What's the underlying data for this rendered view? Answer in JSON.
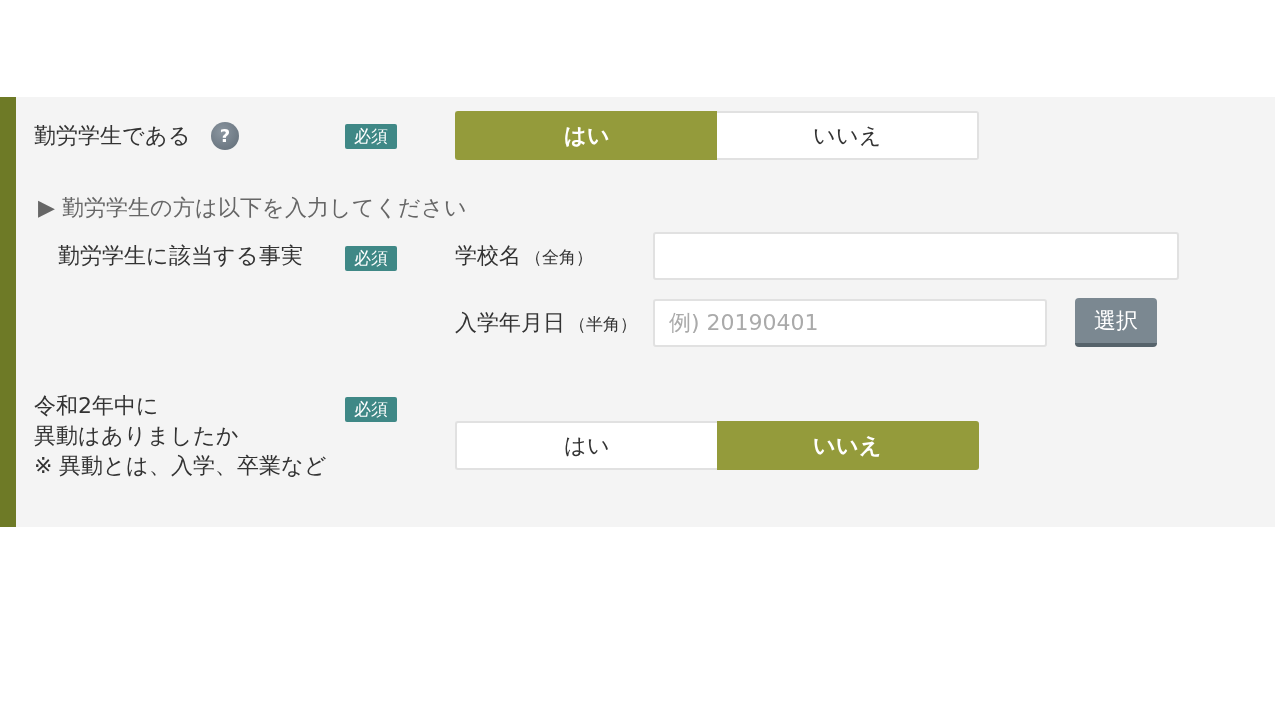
{
  "panel": {
    "rows": [
      {
        "kind": "choice",
        "label_lines": [
          "勤労学生である"
        ],
        "help": "?",
        "badge": "必須",
        "options": [
          {
            "label": "はい",
            "selected": true
          },
          {
            "label": "いいえ",
            "selected": false
          }
        ]
      },
      {
        "kind": "note",
        "text": "▶ 勤労学生の方は以下を入力してください"
      },
      {
        "kind": "fields",
        "label": "勤労学生に該当する事実",
        "badge": "必須",
        "fields": [
          {
            "label": "学校名",
            "hint": "（全角）"
          },
          {
            "label": "入学年月日",
            "hint": "（半角）",
            "placeholder": "例) 20190401",
            "button": "選択"
          }
        ]
      },
      {
        "kind": "choice",
        "label_lines": [
          "令和2年中に",
          "異動はありましたか"
        ],
        "note": "※ 異動とは、入学、卒業など",
        "badge": "必須",
        "options": [
          {
            "label": "はい",
            "selected": false
          },
          {
            "label": "いいえ",
            "selected": true
          }
        ]
      }
    ]
  }
}
